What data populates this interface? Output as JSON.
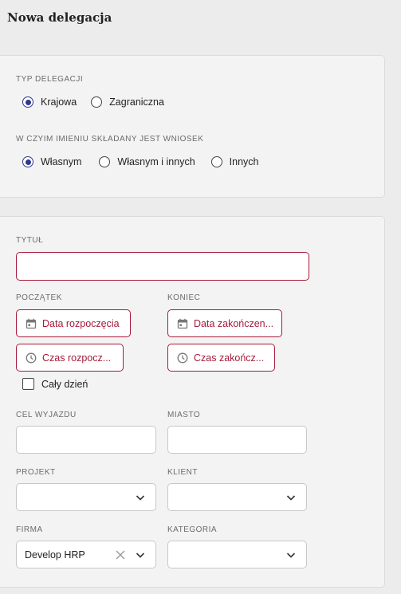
{
  "page": {
    "title": "Nowa delegacja"
  },
  "delegation_type": {
    "label": "TYP DELEGACJI",
    "options": [
      {
        "label": "Krajowa",
        "checked": true
      },
      {
        "label": "Zagraniczna",
        "checked": false
      }
    ]
  },
  "on_behalf": {
    "label": "W CZYIM IMIENIU SKŁADANY JEST WNIOSEK",
    "options": [
      {
        "label": "Własnym",
        "checked": true
      },
      {
        "label": "Własnym i innych",
        "checked": false
      },
      {
        "label": "Innych",
        "checked": false
      }
    ]
  },
  "form": {
    "title_label": "TYTUŁ",
    "title_value": "",
    "start_label": "POCZĄTEK",
    "end_label": "KONIEC",
    "start_date": "Data rozpoczęcia",
    "start_time": "Czas rozpocz...",
    "end_date": "Data zakończen...",
    "end_time": "Czas zakończ...",
    "all_day_label": "Cały dzień",
    "purpose_label": "CEL WYJAZDU",
    "purpose_value": "",
    "city_label": "MIASTO",
    "city_value": "",
    "project_label": "PROJEKT",
    "project_value": "",
    "client_label": "KLIENT",
    "client_value": "",
    "company_label": "FIRMA",
    "company_value": "Develop HRP",
    "category_label": "KATEGORIA",
    "category_value": ""
  },
  "colors": {
    "accent_required": "#a61b3a",
    "radio_checked": "#2d3a8c",
    "background": "#ececec",
    "card": "#f3f3f3"
  },
  "icons": [
    "calendar-icon",
    "clock-icon",
    "chevron-down-icon",
    "clear-icon"
  ]
}
